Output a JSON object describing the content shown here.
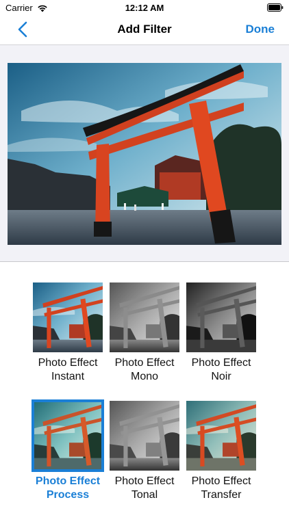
{
  "status_bar": {
    "carrier": "Carrier",
    "time": "12:12 AM",
    "wifi_icon": "wifi-icon",
    "battery_icon": "battery-icon"
  },
  "nav": {
    "back_icon": "chevron-left-icon",
    "title": "Add Filter",
    "done_label": "Done",
    "accent_color": "#1a7fd6"
  },
  "preview": {
    "subject": "torii-gate"
  },
  "filters": [
    {
      "label": "Photo Effect Instant",
      "selected": false
    },
    {
      "label": "Photo Effect Mono",
      "selected": false
    },
    {
      "label": "Photo Effect Noir",
      "selected": false
    },
    {
      "label": "Photo Effect Process",
      "selected": true
    },
    {
      "label": "Photo Effect Tonal",
      "selected": false
    },
    {
      "label": "Photo Effect Transfer",
      "selected": false
    }
  ]
}
